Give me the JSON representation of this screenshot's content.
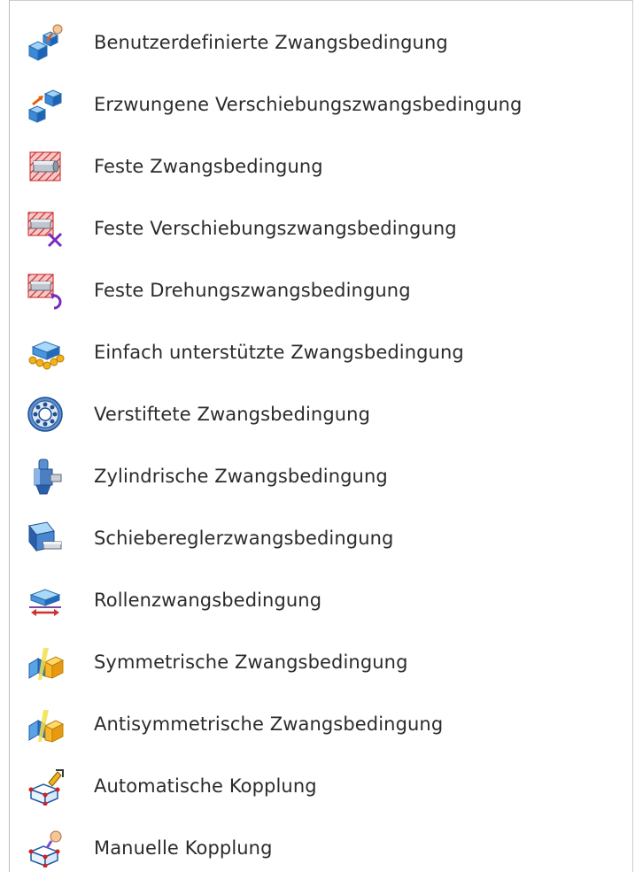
{
  "menu": {
    "items": [
      {
        "label": "Benutzerdefinierte Zwangsbedingung",
        "icon": "custom-constraint-icon"
      },
      {
        "label": "Erzwungene Verschiebungszwangsbedingung",
        "icon": "forced-displacement-icon"
      },
      {
        "label": "Feste Zwangsbedingung",
        "icon": "fixed-constraint-icon"
      },
      {
        "label": "Feste Verschiebungszwangsbedingung",
        "icon": "fixed-displacement-icon"
      },
      {
        "label": "Feste Drehungszwangsbedingung",
        "icon": "fixed-rotation-icon"
      },
      {
        "label": "Einfach unterstützte Zwangsbedingung",
        "icon": "simply-supported-icon"
      },
      {
        "label": "Verstiftete Zwangsbedingung",
        "icon": "pinned-constraint-icon"
      },
      {
        "label": "Zylindrische Zwangsbedingung",
        "icon": "cylindrical-constraint-icon"
      },
      {
        "label": "Schiebereglerzwangsbedingung",
        "icon": "slider-constraint-icon"
      },
      {
        "label": "Rollenzwangsbedingung",
        "icon": "roller-constraint-icon"
      },
      {
        "label": "Symmetrische Zwangsbedingung",
        "icon": "symmetric-constraint-icon"
      },
      {
        "label": "Antisymmetrische Zwangsbedingung",
        "icon": "antisymmetric-constraint-icon"
      },
      {
        "label": "Automatische Kopplung",
        "icon": "automatic-coupling-icon"
      },
      {
        "label": "Manuelle Kopplung",
        "icon": "manual-coupling-icon"
      }
    ]
  }
}
